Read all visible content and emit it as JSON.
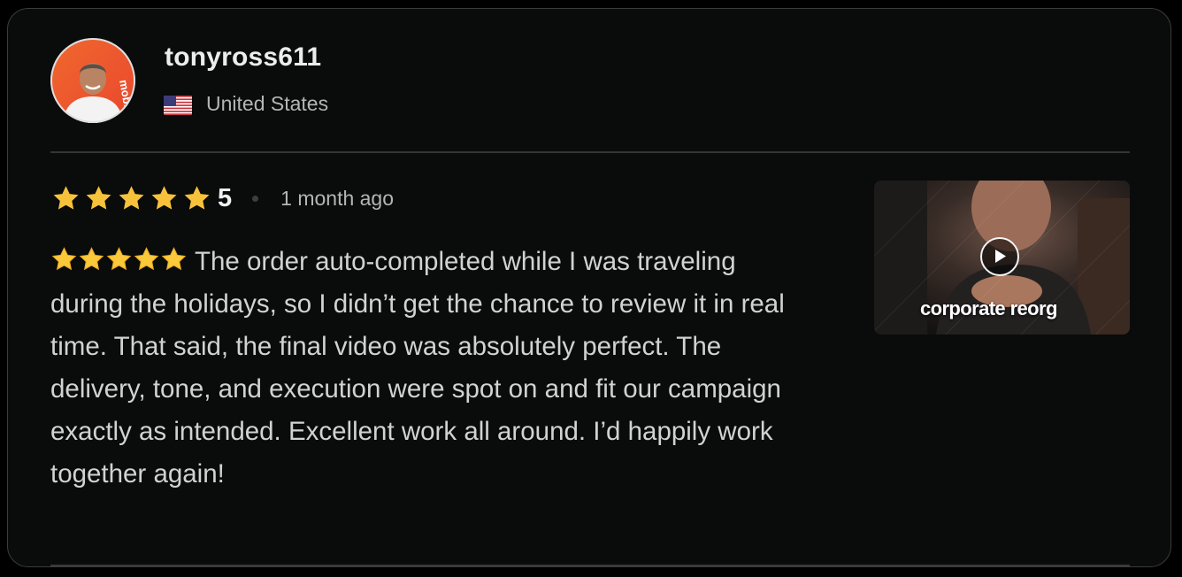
{
  "reviewer": {
    "username": "tonyross611",
    "country": "United States",
    "avatar_icon": "person-avatar",
    "flag_icon": "us-flag-icon"
  },
  "rating": {
    "stars": 5,
    "value": "5",
    "time_ago": "1 month ago",
    "star_color": "#f7c23b"
  },
  "review": {
    "body": "The order auto-completed while I was traveling during the holidays, so I didn’t get the chance to review it in real time. That said, the final video was absolutely perfect. The delivery, tone, and execution were spot on and fit our campaign exactly as intended. Excellent work all around. I’d happily work together again!"
  },
  "attachment": {
    "caption": "corporate reorg",
    "play_icon": "play-icon"
  },
  "colors": {
    "background": "#0a0b0b",
    "text": "#d2d2d2",
    "muted": "#b5b5b5",
    "border": "#3c3c3c"
  }
}
